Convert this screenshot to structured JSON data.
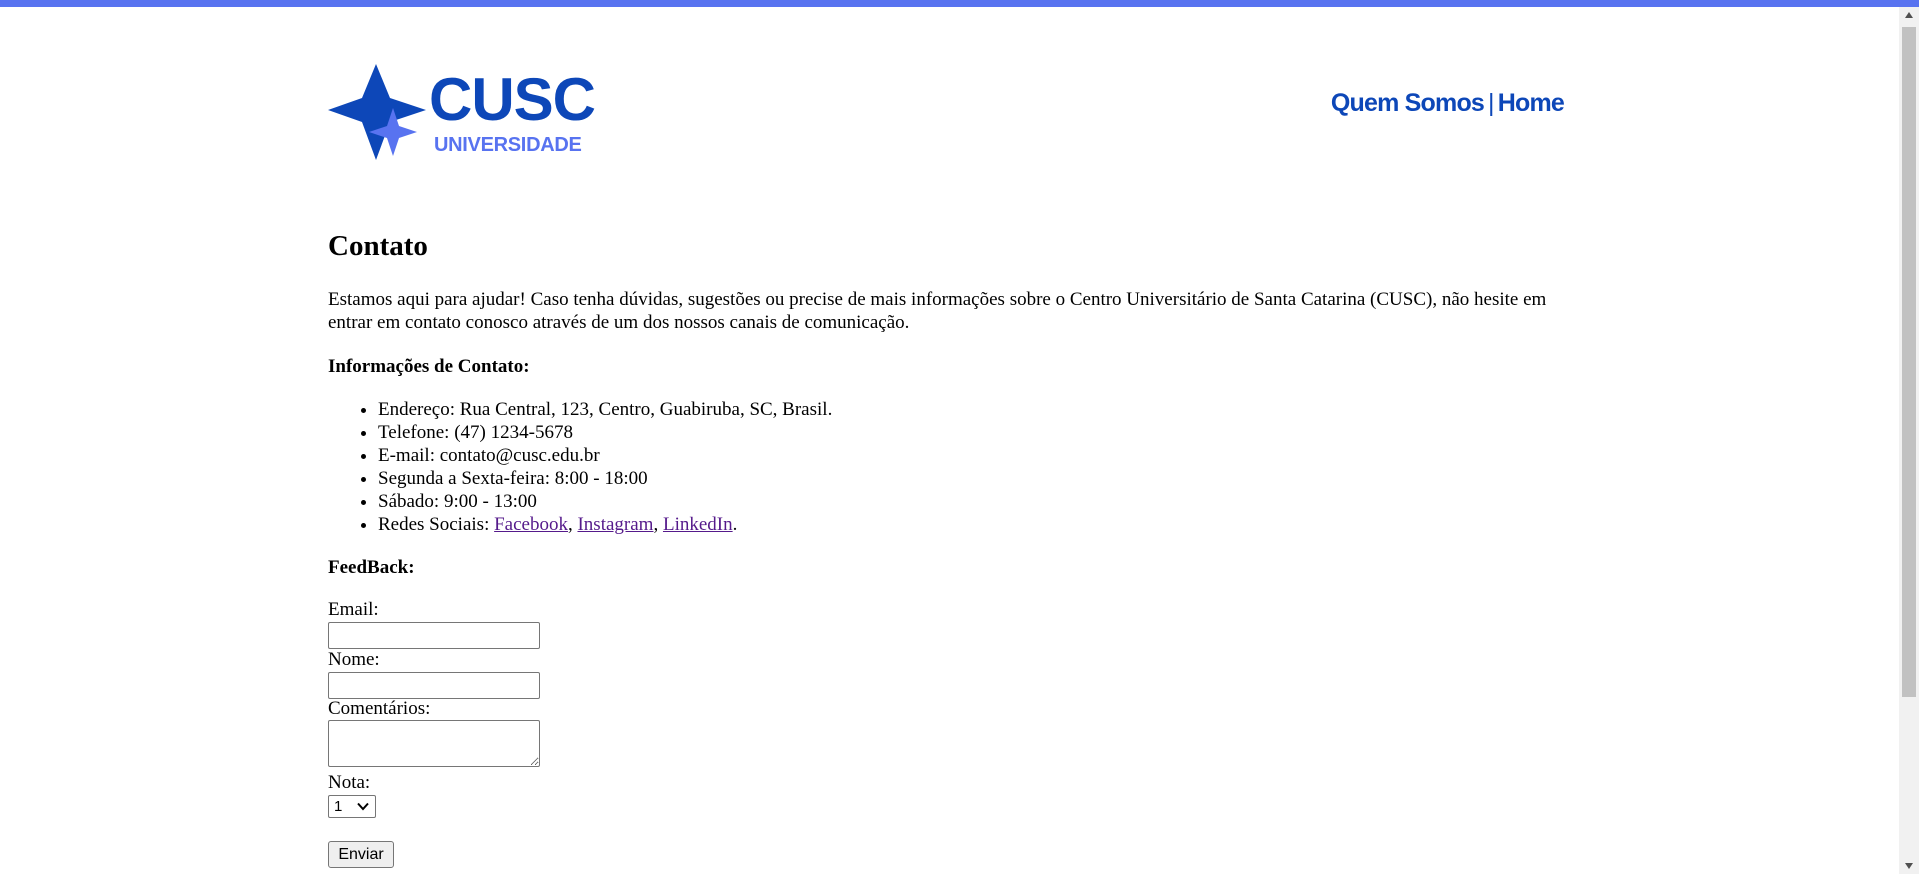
{
  "brand": {
    "name": "CUSC",
    "subtitle": "UNIVERSIDADE",
    "accent": "#5873f0",
    "primary": "#0d47b8"
  },
  "nav": {
    "quem_somos": "Quem Somos",
    "separator": "|",
    "home": "Home"
  },
  "page": {
    "title": "Contato",
    "intro": "Estamos aqui para ajudar! Caso tenha dúvidas, sugestões ou precise de mais informações sobre o Centro Universitário de Santa Catarina (CUSC), não hesite em entrar em contato conosco através de um dos nossos canais de comunicação."
  },
  "contact_info": {
    "heading": "Informações de Contato:",
    "items": [
      "Endereço: Rua Central, 123, Centro, Guabiruba, SC, Brasil.",
      "Telefone: (47) 1234-5678",
      "E-mail: contato@cusc.edu.br",
      "Segunda a Sexta-feira: 8:00 - 18:00",
      "Sábado: 9:00 - 13:00"
    ],
    "social_prefix": "Redes Sociais: ",
    "social_links": [
      "Facebook",
      "Instagram",
      "LinkedIn"
    ],
    "social_comma": ", ",
    "social_end": "."
  },
  "feedback": {
    "heading": "FeedBack:",
    "email_label": "Email:",
    "email_value": "",
    "name_label": "Nome:",
    "name_value": "",
    "comments_label": "Comentários:",
    "comments_value": "",
    "rating_label": "Nota:",
    "rating_value": "1",
    "submit_label": "Enviar"
  },
  "icons": {
    "logo": "star-logo-icon",
    "select_arrow": "chevron-down-icon",
    "scroll_up": "scroll-up-arrow-icon",
    "scroll_down": "scroll-down-arrow-icon"
  }
}
